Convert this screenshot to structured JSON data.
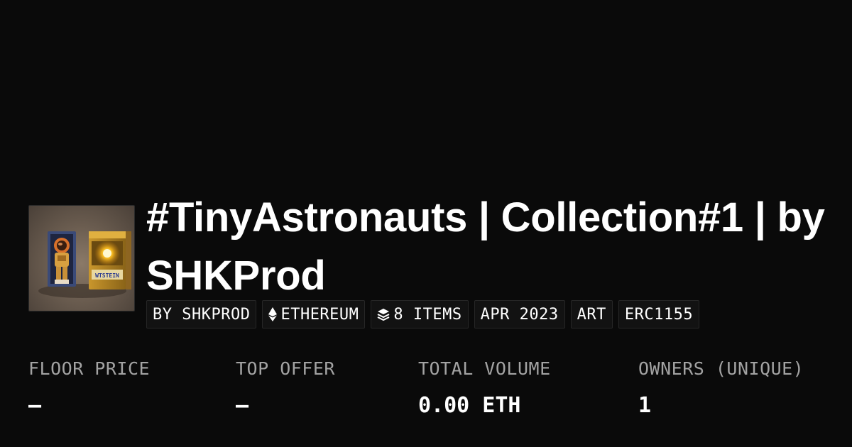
{
  "collection": {
    "title_line1": "#TinyAstronauts | Collection#1 | by",
    "title_line2": "SHKProd",
    "image_alt": "TinyAstronauts collection image"
  },
  "tags": [
    {
      "label": "BY SHKPROD",
      "icon": null
    },
    {
      "label": "ETHEREUM",
      "icon": "ethereum-icon"
    },
    {
      "label": "8 ITEMS",
      "icon": "layers-icon"
    },
    {
      "label": "APR 2023",
      "icon": null
    },
    {
      "label": "ART",
      "icon": null
    },
    {
      "label": "ERC1155",
      "icon": null
    }
  ],
  "stats": {
    "floor_price": {
      "label": "FLOOR PRICE",
      "value": "—"
    },
    "top_offer": {
      "label": "TOP OFFER",
      "value": "—"
    },
    "total_volume": {
      "label": "TOTAL VOLUME",
      "value": "0.00 ETH"
    },
    "owners": {
      "label": "OWNERS (UNIQUE)",
      "value": "1"
    }
  },
  "colors": {
    "background": "#0a0a0a",
    "text": "#ffffff",
    "muted": "#a3a3a3",
    "chip_background": "#121212",
    "chip_border": "#262626"
  }
}
